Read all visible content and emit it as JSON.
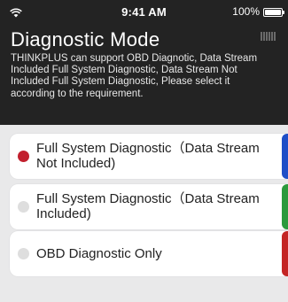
{
  "status_bar": {
    "time": "9:41 AM",
    "battery_percent": "100%",
    "icons": [
      "wifi-icon",
      "battery-icon"
    ]
  },
  "header": {
    "title": "Diagnostic Mode",
    "description": "THINKPLUS can support OBD Diagnotic,  Data Stream Included Full System Diagnostic,  Data Stream Not Included Full System Diagnostic, Please select it according to the requirement."
  },
  "options": [
    {
      "label": "Full System Diagnostic（Data Stream Not Included)",
      "selected": true,
      "accent_color": "#1f4ec7",
      "radio_color": "#c2202e"
    },
    {
      "label": "Full System Diagnostic（Data Stream Included)",
      "selected": false,
      "accent_color": "#2b9a3c",
      "radio_color": "#dedede"
    },
    {
      "label": "OBD Diagnostic Only",
      "selected": false,
      "accent_color": "#c42424",
      "radio_color": "#dedede"
    }
  ],
  "colors": {
    "header_bg": "#232323",
    "content_bg": "#e9e9ea",
    "card_bg": "#ffffff"
  }
}
